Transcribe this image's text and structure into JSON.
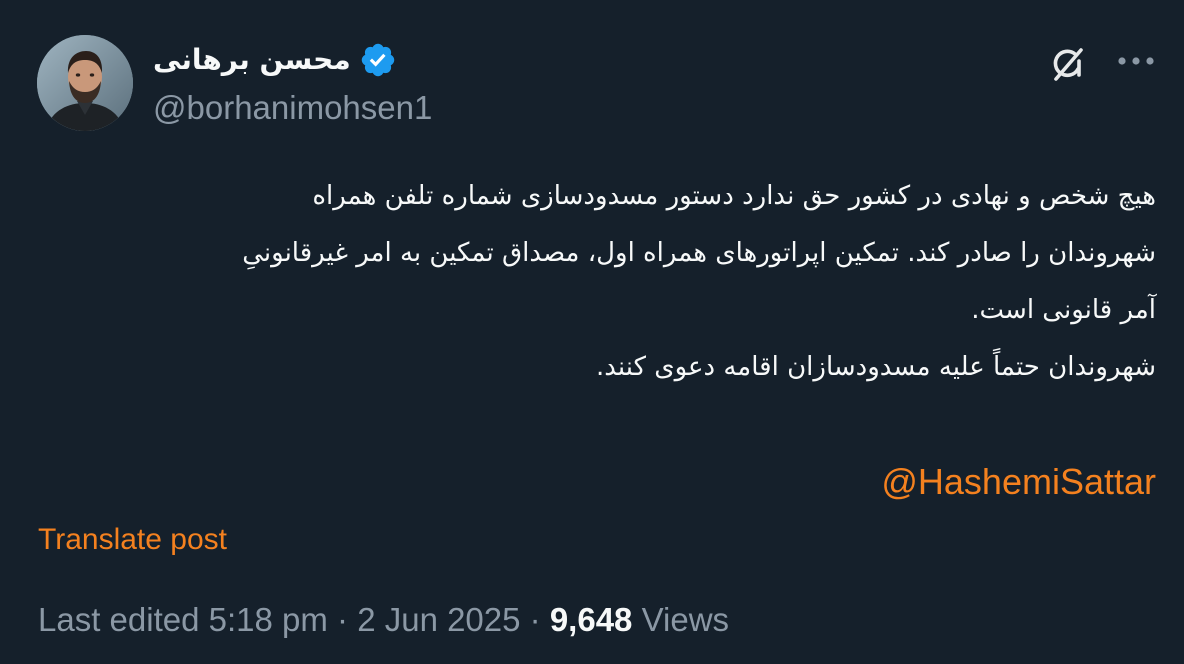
{
  "author": {
    "display_name": "محسن برهانی",
    "handle": "@borhanimohsen1",
    "verified": true
  },
  "icons": {
    "avatar": "profile-photo",
    "verified": "verified-badge-icon",
    "grok": "grok-icon",
    "more": "more-options-icon"
  },
  "colors": {
    "background": "#15202b",
    "accent": "#f4811f",
    "verified": "#1d9bf0",
    "secondary_text": "#8b98a5"
  },
  "post": {
    "lines": [
      "هیچ شخص و نهادی در کشور حق ندارد دستور مسدودسازی شماره تلفن همراه",
      "شهروندان را صادر کند. تمکین اپراتورهای همراه اول، مصداق تمکین به امر غیرقانونیِ",
      "آمر قانونی است.",
      "شهروندان حتماً علیه مسدودسازان اقامه دعوی کنند."
    ],
    "mention": "@HashemiSattar"
  },
  "translate_label": "Translate post",
  "meta": {
    "edited_label": "Last edited 5:18 pm · 2 Jun 2025 · ",
    "views_count": "9,648",
    "views_label": " Views"
  }
}
